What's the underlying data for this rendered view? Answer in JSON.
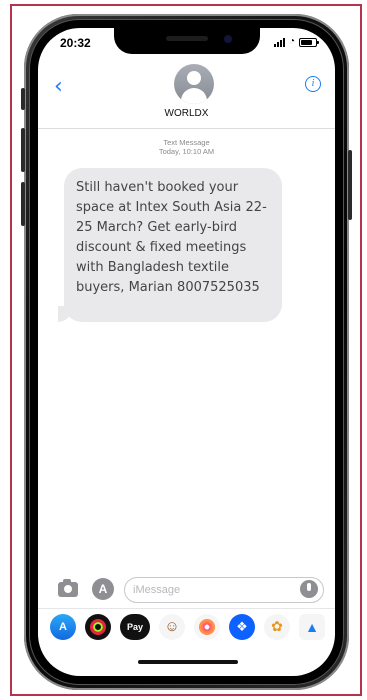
{
  "status_bar": {
    "time": "20:32"
  },
  "header": {
    "back_glyph": "‹",
    "contact_name": "WORLDX",
    "info_glyph": "i"
  },
  "conversation": {
    "timestamp_line1": "Text Message",
    "timestamp_line2": "Today, 10:10 AM",
    "messages": [
      {
        "text": "Still haven't booked your space at Intex South Asia 22-25 March? Get early-bird discount & fixed meetings with Bangladesh textile buyers, Marian 8007525035"
      }
    ]
  },
  "composer": {
    "placeholder": "iMessage",
    "appstore_glyph": "A"
  },
  "app_drawer": {
    "apple_pay_label": "Pay",
    "icons": [
      "app-store-icon",
      "activity-icon",
      "apple-pay-icon",
      "animoji-icon",
      "music-icon",
      "dropbox-icon",
      "photos-icon",
      "more-icon"
    ]
  },
  "colors": {
    "accent": "#1a7cf5",
    "bubble": "#e9e9eb",
    "frame_border": "#b5334c"
  }
}
